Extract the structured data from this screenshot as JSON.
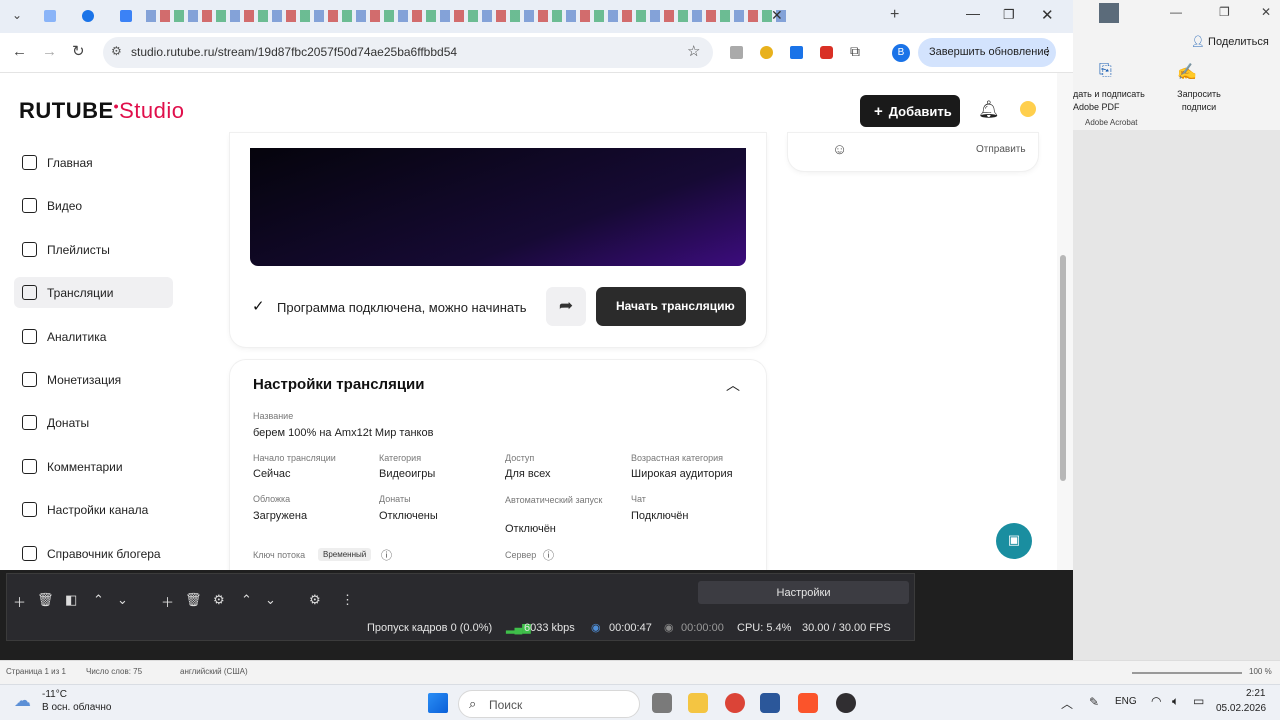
{
  "browser": {
    "url": "studio.rutube.ru/stream/19d87fbc2057f50d74ae25ba6ffbbd54",
    "update_label": "Завершить обновление",
    "profile_initial": "B"
  },
  "rutube": {
    "logo_main": "RUTUBE",
    "logo_studio": "Studio",
    "add_label": "Добавить",
    "comment_send": "Отправить",
    "nav": [
      {
        "label": "Главная",
        "icon": "home-icon"
      },
      {
        "label": "Видео",
        "icon": "video-icon"
      },
      {
        "label": "Плейлисты",
        "icon": "playlist-icon"
      },
      {
        "label": "Трансляции",
        "icon": "broadcast-icon",
        "active": true
      },
      {
        "label": "Аналитика",
        "icon": "analytics-icon"
      },
      {
        "label": "Монетизация",
        "icon": "monetization-icon"
      },
      {
        "label": "Донаты",
        "icon": "donate-icon"
      },
      {
        "label": "Комментарии",
        "icon": "comments-icon"
      },
      {
        "label": "Настройки канала",
        "icon": "channel-settings-icon"
      },
      {
        "label": "Справочник блогера",
        "icon": "help-icon"
      }
    ],
    "stream": {
      "status": "Программа подключена, можно начинать",
      "start_label": "Начать трансляцию"
    },
    "settings": {
      "title": "Настройки трансляции",
      "name_label": "Название",
      "name_value": "берем 100% на Amx12t Мир танков",
      "fields": [
        {
          "label": "Начало трансляции",
          "value": "Сейчас"
        },
        {
          "label": "Категория",
          "value": "Видеоигры"
        },
        {
          "label": "Доступ",
          "value": "Для всех"
        },
        {
          "label": "Возрастная категория",
          "value": "Широкая аудитория"
        },
        {
          "label": "Обложка",
          "value": "Загружена"
        },
        {
          "label": "Донаты",
          "value": "Отключены"
        },
        {
          "label": "Автоматический запуск",
          "value": "Отключён"
        },
        {
          "label": "Чат",
          "value": "Подключён"
        }
      ],
      "stream_key_label": "Ключ потока",
      "stream_key_badge": "Временный",
      "server_label": "Сервер"
    }
  },
  "obs": {
    "settings_label": "Настройки",
    "dropped_frames": "Пропуск кадров 0 (0.0%)",
    "bitrate": "6033 kbps",
    "stream_time": "00:00:47",
    "record_time": "00:00:00",
    "cpu": "CPU: 5.4%",
    "fps": "30.00 / 30.00 FPS"
  },
  "acrobat": {
    "share_label": "Поделиться",
    "convert_label": "дать и подписать Adobe PDF",
    "request_sign_label": "Запросить подписи",
    "acrobat_label": "Adobe Acrobat"
  },
  "word_status": {
    "page": "Страница 1 из 1",
    "words": "Число слов: 75",
    "language": "английский (США)",
    "zoom": "100 %"
  },
  "taskbar": {
    "temperature": "-11°C",
    "weather": "В осн. облачно",
    "search_placeholder": "Поиск",
    "lang": "ENG",
    "time": "2:21",
    "date": "05.02.2026"
  },
  "colors": {
    "accent": "#e00f4b",
    "fab": "#1a8ea0"
  }
}
